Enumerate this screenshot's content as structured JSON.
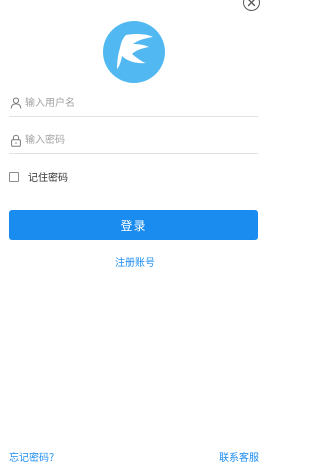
{
  "icons": {
    "close": "close-icon",
    "logo": "feather-logo",
    "user": "user-icon",
    "lock": "lock-icon"
  },
  "colors": {
    "accent": "#1a8cf0",
    "logo_bg": "#52b8f2"
  },
  "form": {
    "username_placeholder": "输入用户名",
    "username_value": "",
    "password_placeholder": "输入密码",
    "password_value": "",
    "remember_label": "记住密码",
    "remember_checked": false,
    "login_label": "登录"
  },
  "links": {
    "register": "注册账号",
    "forgot_password": "忘记密码？",
    "contact_support": "联系客服"
  }
}
